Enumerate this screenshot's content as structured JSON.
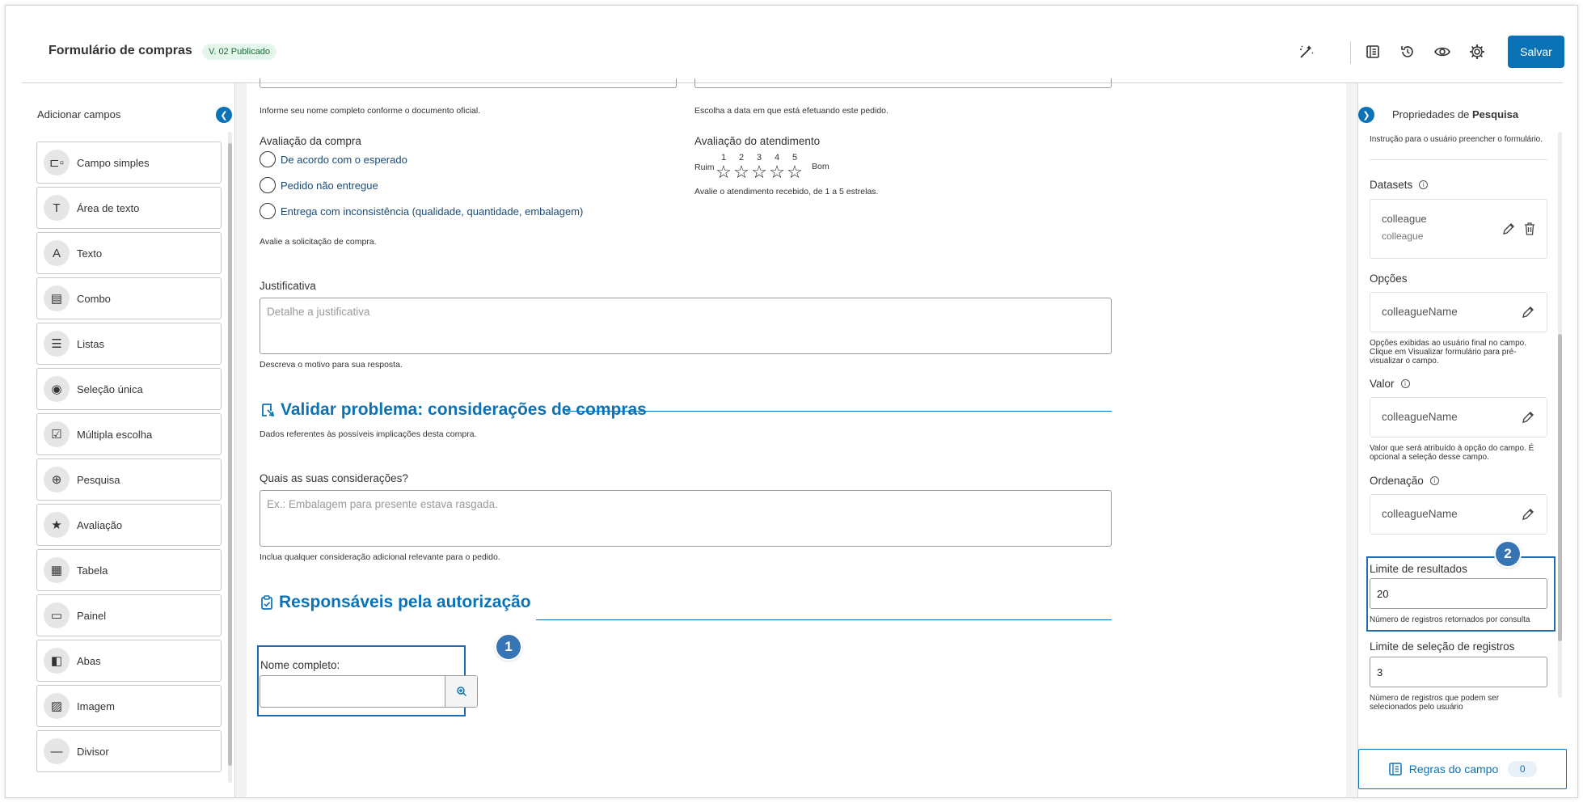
{
  "header": {
    "title": "Formulário de compras",
    "version_badge": "V. 02 Publicado",
    "save_label": "Salvar",
    "icons": [
      "magic-wand-icon",
      "document-list-icon",
      "history-icon",
      "preview-eye-icon",
      "gear-icon"
    ]
  },
  "left_panel": {
    "title": "Adicionar campos",
    "items": [
      {
        "label": "Campo simples",
        "icon": "simple-field-icon",
        "glyph": "⊏▫"
      },
      {
        "label": "Área de texto",
        "icon": "text-area-icon",
        "glyph": "T"
      },
      {
        "label": "Texto",
        "icon": "text-icon",
        "glyph": "A"
      },
      {
        "label": "Combo",
        "icon": "combo-icon",
        "glyph": "▤"
      },
      {
        "label": "Listas",
        "icon": "list-icon",
        "glyph": "☰"
      },
      {
        "label": "Seleção única",
        "icon": "single-select-icon",
        "glyph": "◉"
      },
      {
        "label": "Múltipla escolha",
        "icon": "checkbox-icon",
        "glyph": "☑"
      },
      {
        "label": "Pesquisa",
        "icon": "search-icon",
        "glyph": "⊕"
      },
      {
        "label": "Avaliação",
        "icon": "star-icon",
        "glyph": "★"
      },
      {
        "label": "Tabela",
        "icon": "table-icon",
        "glyph": "▦"
      },
      {
        "label": "Painel",
        "icon": "panel-icon",
        "glyph": "▭"
      },
      {
        "label": "Abas",
        "icon": "tabs-icon",
        "glyph": "◧"
      },
      {
        "label": "Imagem",
        "icon": "image-icon",
        "glyph": "▨"
      },
      {
        "label": "Divisor",
        "icon": "divider-icon",
        "glyph": "—"
      }
    ]
  },
  "form": {
    "name_help": "Informe seu nome completo conforme o documento oficial.",
    "date_help": "Escolha a data em que está efetuando este pedido.",
    "purchase_rating": {
      "label": "Avaliação da compra",
      "options": [
        "De acordo com o esperado",
        "Pedido não entregue",
        "Entrega com inconsistência (qualidade, quantidade, embalagem)"
      ],
      "help": "Avalie a solicitação de compra."
    },
    "service_rating": {
      "label": "Avaliação do atendimento",
      "low": "Ruim",
      "high": "Bom",
      "numbers": [
        "1",
        "2",
        "3",
        "4",
        "5"
      ],
      "value": 0,
      "help": "Avalie o atendimento recebido, de 1 a 5 estrelas."
    },
    "justification": {
      "label": "Justificativa",
      "placeholder": "Detalhe a justificativa",
      "help": "Descreva o motivo para sua resposta."
    },
    "section_validate": {
      "title": "Validar problema: considerações de compras",
      "subtitle": "Dados referentes às possíveis implicações desta compra."
    },
    "considerations": {
      "label": "Quais as suas considerações?",
      "placeholder": "Ex.: Embalagem para presente estava rasgada.",
      "help": "Inclua qualquer consideração adicional relevante para o pedido."
    },
    "section_responsible": {
      "title": "Responsáveis pela autorização"
    },
    "full_name": {
      "label": "Nome completo:",
      "value": ""
    },
    "callout_1": "1"
  },
  "right_panel": {
    "title_prefix": "Propriedades de ",
    "title_bold": "Pesquisa",
    "truncated_text": "Instrução para o usuário preencher o formulário.",
    "datasets": {
      "label": "Datasets",
      "value1": "colleague",
      "value2": "colleague"
    },
    "options": {
      "label": "Opções",
      "value": "colleagueName",
      "help": "Opções exibidas ao usuário final no campo. Clique em Visualizar formulário para pré-visualizar o campo."
    },
    "value": {
      "label": "Valor",
      "value": "colleagueName",
      "help": "Valor que será atribuído à opção do campo. É opcional a seleção desse campo."
    },
    "ordering": {
      "label": "Ordenação",
      "value": "colleagueName"
    },
    "results_limit": {
      "label": "Limite de resultados",
      "value": "20",
      "help": "Número de registros retornados por consulta"
    },
    "selection_limit": {
      "label": "Limite de seleção de registros",
      "value": "3",
      "help": "Número de registros que podem ser selecionados pelo usuário"
    },
    "rules": {
      "label": "Regras do campo",
      "count": "0"
    },
    "callout_2": "2"
  },
  "colors": {
    "accent": "#0c72b6",
    "callout": "#3774b4",
    "badge_bg": "#e4f5ea",
    "badge_text": "#1d6b3a"
  }
}
